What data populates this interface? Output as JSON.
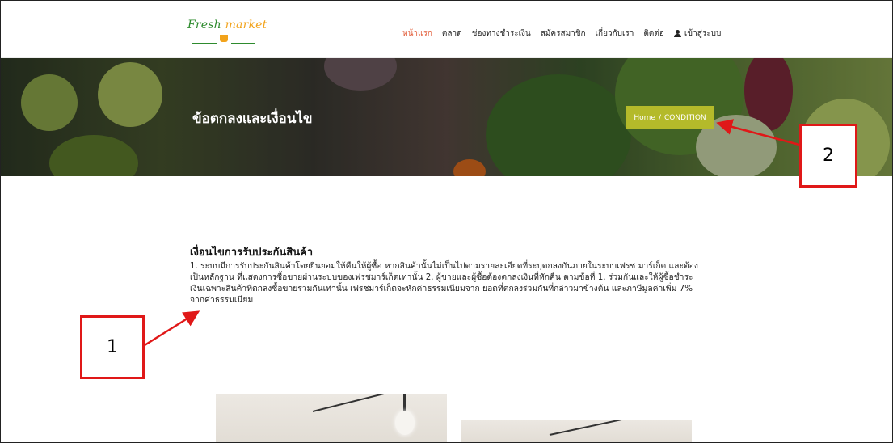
{
  "header": {
    "logo": {
      "word1": "Fresh",
      "word2": "market",
      "brand_green": "#2e8b2e",
      "brand_orange": "#f2a31b"
    },
    "menu": [
      {
        "label": "หน้าแรก",
        "active": true
      },
      {
        "label": "ตลาด",
        "active": false
      },
      {
        "label": "ช่องทางชำระเงิน",
        "active": false
      },
      {
        "label": "สมัครสมาชิก",
        "active": false
      },
      {
        "label": "เกี่ยวกับเรา",
        "active": false
      },
      {
        "label": "ติดต่อ",
        "active": false
      }
    ],
    "login_label": "เข้าสู่ระบบ",
    "login_icon": "user-icon",
    "active_color": "#e25d3a"
  },
  "hero": {
    "title": "ข้อตกลงและเงื่อนไข",
    "breadcrumb": {
      "home": "Home",
      "separator": "/",
      "current": "CONDITION"
    },
    "breadcrumb_color": "#b4ba2a"
  },
  "content": {
    "title": "เงื่อนไขการรับประกันสินค้า",
    "paragraph": "1. ระบบมีการรับประกันสินค้าโดยยินยอมให้คืนให้ผู้ซื้อ หากสินค้านั้นไม่เป็นไปตามรายละเอียดที่ระบุตกลงกันภายในระบบเฟรช มาร์เก็ต และต้องเป็นหลักฐาน ที่แสดงการซื้อขายผ่านระบบของเฟรชมาร์เก็ตเท่านั้น 2. ผู้ขายและผู้ซื้อต้องตกลงเงินที่หักคืน ตามข้อที่ 1. ร่วมกันและให้ผู้ซื้อชำระเงินเฉพาะสินค้าที่ตกลงซื้อขายร่วมกันเท่านั้น เฟรชมาร์เก็ตจะหักค่าธรรมเนียมจาก ยอดที่ตกลงร่วมกันที่กล่าวมาข้างต้น และภาษีมูลค่าเพิ่ม 7% จากค่าธรรมเนียม"
  },
  "annotations": {
    "callout_1": "1",
    "callout_2": "2",
    "color": "#e01818"
  }
}
